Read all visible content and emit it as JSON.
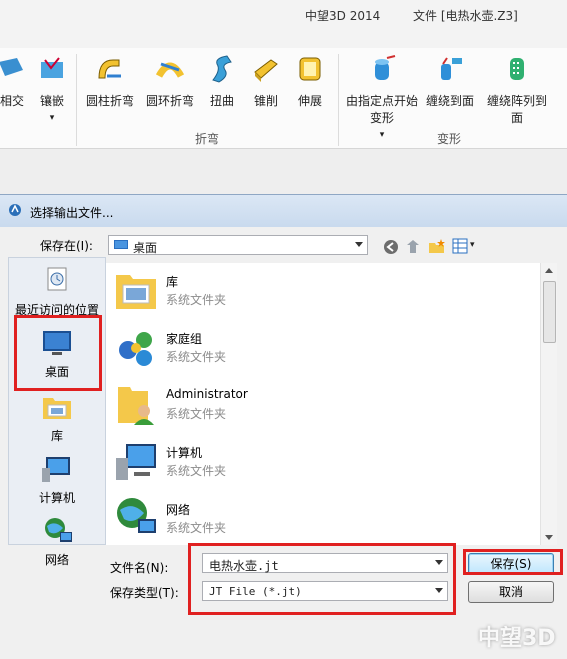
{
  "app": {
    "product": "中望3D 2014",
    "file_label": "文件 [电热水壶.Z3]",
    "ribbon": {
      "buttons": [
        {
          "label": "相交"
        },
        {
          "label": "镶嵌"
        },
        {
          "label": "圆柱折弯"
        },
        {
          "label": "圆环折弯"
        },
        {
          "label": "扭曲"
        },
        {
          "label": "锥削"
        },
        {
          "label": "伸展"
        },
        {
          "label": "由指定点开始变形"
        },
        {
          "label": "缠绕到面"
        },
        {
          "label": "缠绕阵列到面"
        }
      ],
      "groups": [
        "折弯",
        "变形"
      ]
    }
  },
  "dialog": {
    "title": "选择输出文件...",
    "save_in_label": "保存在(I):",
    "save_in_value": "桌面",
    "places": [
      {
        "label": "最近访问的位置",
        "icon": "recent-places-icon"
      },
      {
        "label": "桌面",
        "icon": "desktop-icon"
      },
      {
        "label": "库",
        "icon": "library-icon"
      },
      {
        "label": "计算机",
        "icon": "computer-icon"
      },
      {
        "label": "网络",
        "icon": "network-icon"
      }
    ],
    "files": [
      {
        "name": "库",
        "type": "系统文件夹",
        "icon": "library-folder-icon"
      },
      {
        "name": "家庭组",
        "type": "系统文件夹",
        "icon": "homegroup-icon"
      },
      {
        "name": "Administrator",
        "type": "系统文件夹",
        "icon": "user-folder-icon"
      },
      {
        "name": "计算机",
        "type": "系统文件夹",
        "icon": "computer-icon"
      },
      {
        "name": "网络",
        "type": "系统文件夹",
        "icon": "network-icon"
      }
    ],
    "filename_label": "文件名(N):",
    "filename_value": "电热水壶.jt",
    "filetype_label": "保存类型(T):",
    "filetype_value": "JT File (*.jt)",
    "save_button": "保存(S)",
    "cancel_button": "取消"
  },
  "watermark": "中望3D",
  "colors": {
    "highlight_box": "#e02020",
    "accent": "#3c7fb1"
  }
}
